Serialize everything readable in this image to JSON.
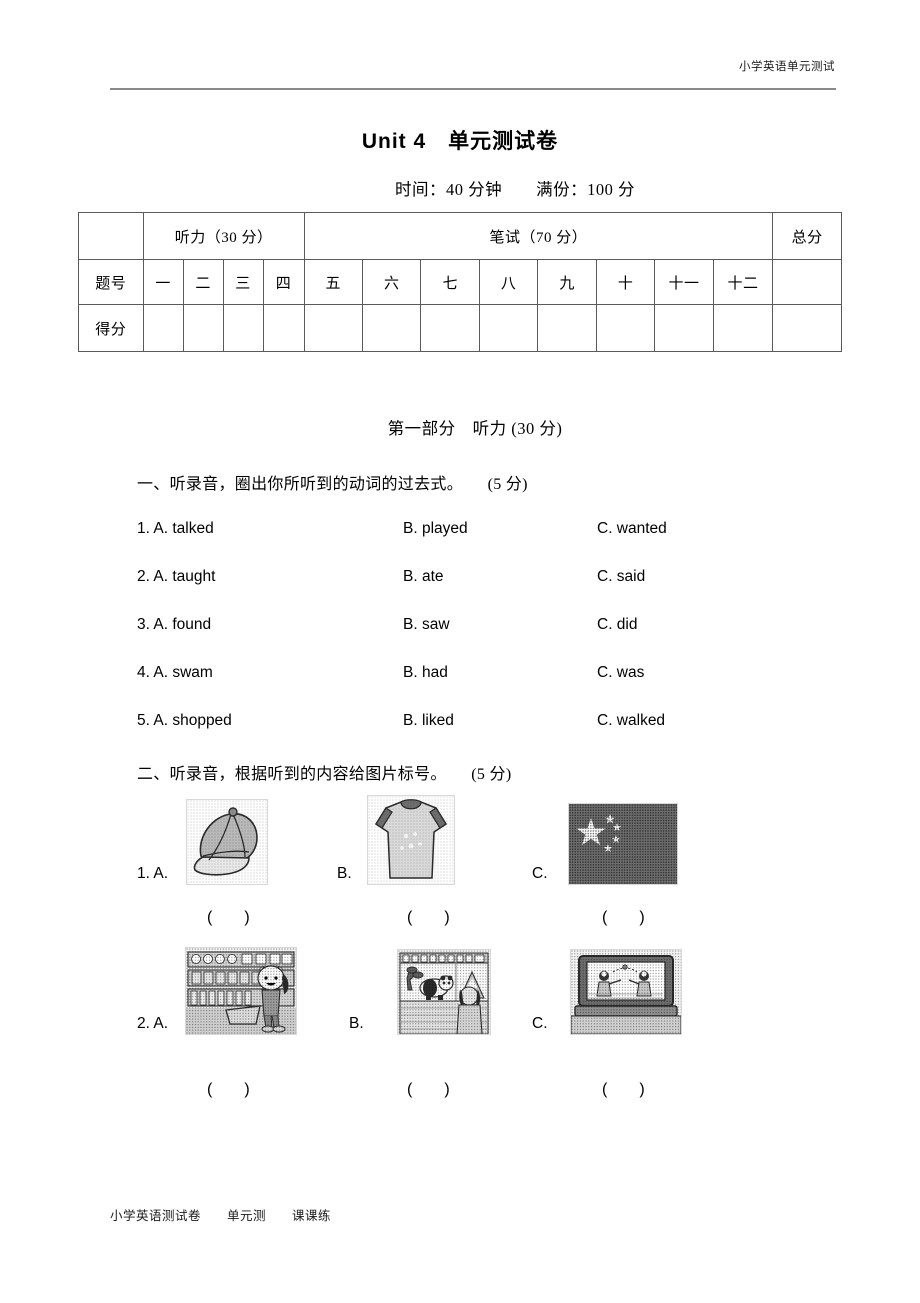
{
  "header": {
    "running_head": "小学英语单元测试"
  },
  "title": "Unit 4　单元测试卷",
  "subtitle": "时间：40 分钟　　满份：100 分",
  "score_table": {
    "listening_header": "听力（30 分）",
    "written_header": "笔试（70 分）",
    "total_header": "总分",
    "row_labels": {
      "number": "题号",
      "score": "得分"
    },
    "listening_items": [
      "一",
      "二",
      "三",
      "四"
    ],
    "written_items": [
      "五",
      "六",
      "七",
      "八",
      "九",
      "十",
      "十一",
      "十二"
    ]
  },
  "part_one": {
    "heading": "第一部分　听力 (30 分)"
  },
  "questions": [
    {
      "prompt": "一、听录音，圈出你所听到的动词的过去式。　　(5 分)",
      "items": [
        {
          "a": "1. A. talked",
          "b": "B. played",
          "c": "C. wanted"
        },
        {
          "a": "2. A. taught",
          "b": "B. ate",
          "c": "C. said"
        },
        {
          "a": "3. A. found",
          "b": "B. saw",
          "c": "C. did"
        },
        {
          "a": "4. A. swam",
          "b": "B. had",
          "c": "C. was"
        },
        {
          "a": "5. A. shopped",
          "b": "B. liked",
          "c": "C. walked"
        }
      ]
    },
    {
      "prompt": "二、听录音，根据听到的内容给图片标号。　　(5 分)",
      "picture_rows": [
        {
          "options": [
            {
              "label": "1. A.",
              "picture": "baseball-cap-picture",
              "blank": "(　　)"
            },
            {
              "label": "B.",
              "picture": "t-shirt-picture",
              "blank": "(　　)"
            },
            {
              "label": "C.",
              "picture": "china-flag-picture",
              "blank": "(　　)"
            }
          ]
        },
        {
          "options": [
            {
              "label": "2. A.",
              "picture": "supermarket-shopping-picture",
              "blank": "(　　)"
            },
            {
              "label": "B.",
              "picture": "zoo-panda-picture",
              "blank": "(　　)"
            },
            {
              "label": "C.",
              "picture": "television-cartoon-picture",
              "blank": "(　　)"
            }
          ]
        }
      ]
    }
  ],
  "footer": "小学英语测试卷　　单元测　　课课练",
  "colors": {
    "text": "#000000",
    "rule": "#8a8a8a",
    "table_border": "#5a5a5a",
    "flag_field": "#6f6f6f"
  }
}
